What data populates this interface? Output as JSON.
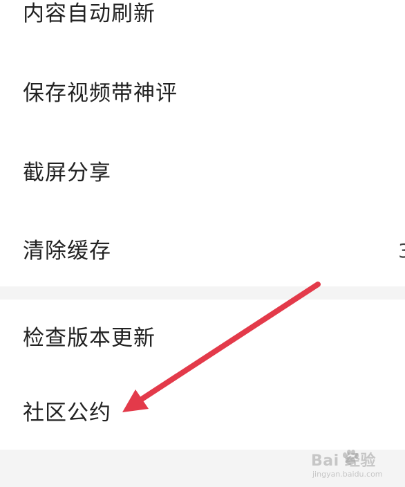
{
  "settings": {
    "group1": [
      {
        "label": "内容自动刷新"
      },
      {
        "label": "保存视频带神评"
      },
      {
        "label": "截屏分享"
      },
      {
        "label": "清除缓存",
        "value": "3"
      }
    ],
    "group2": [
      {
        "label": "检查版本更新"
      },
      {
        "label": "社区公约"
      }
    ]
  },
  "annotation": {
    "arrow_color": "#e33a4a",
    "points_to": "社区公约"
  },
  "watermark": {
    "brand": "Bai  经验",
    "url": "jingyan.baidu.com"
  },
  "colors": {
    "background": "#f4f4f4",
    "panel": "#ffffff",
    "text": "#222222"
  }
}
